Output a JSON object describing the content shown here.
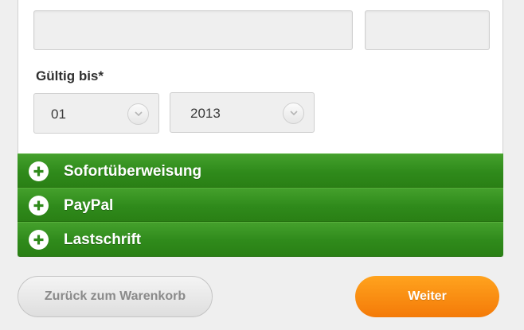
{
  "form": {
    "card_number_value": "",
    "card_cvc_value": "",
    "expiry_label": "Gültig bis*",
    "expiry_month": "01",
    "expiry_year": "2013"
  },
  "payment_methods": [
    {
      "label": "Sofortüberweisung",
      "icon": "plus-circle-icon"
    },
    {
      "label": "PayPal",
      "icon": "plus-circle-icon"
    },
    {
      "label": "Lastschrift",
      "icon": "plus-circle-icon"
    }
  ],
  "actions": {
    "back_label": "Zurück zum Warenkorb",
    "next_label": "Weiter"
  },
  "colors": {
    "accordion_green": "#2f8a1b",
    "primary_orange": "#f7861a",
    "background": "#efefef"
  }
}
